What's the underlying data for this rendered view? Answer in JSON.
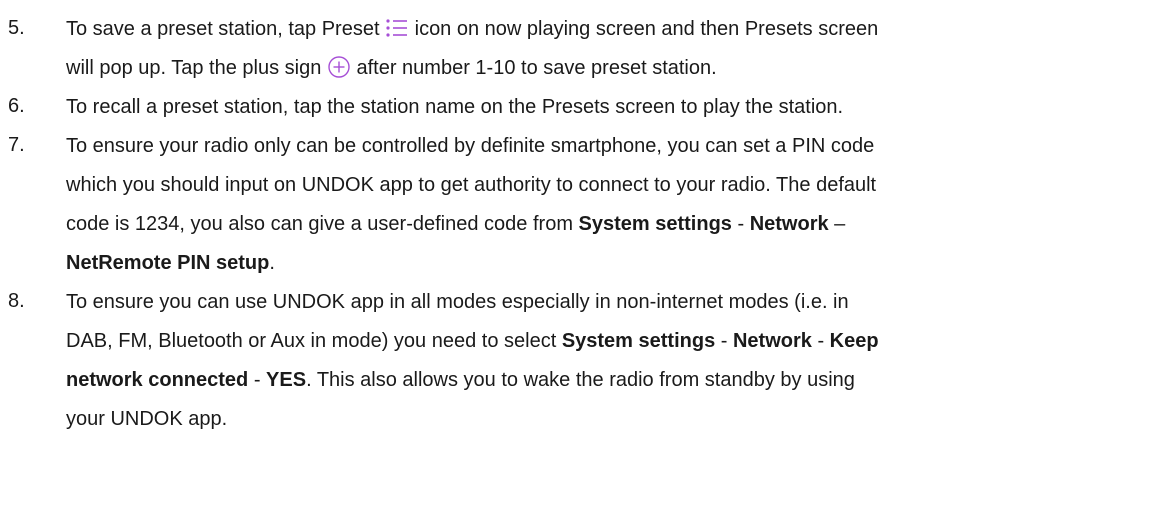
{
  "icons": {
    "preset": "preset-list-icon",
    "plus": "plus-circle-icon",
    "accent_color": "#a64fd6"
  },
  "items": [
    {
      "number": "5.",
      "lines": [
        [
          "To save a preset station, tap Preset ",
          " icon on now playing screen and then Presets screen"
        ],
        [
          "will pop up. Tap the plus sign ",
          " after number 1-10 to save preset station."
        ]
      ]
    },
    {
      "number": "6.",
      "lines": [
        [
          "To recall a preset station, tap the station name on the Presets screen to play the station."
        ]
      ]
    },
    {
      "number": "7.",
      "lines": [
        [
          "To ensure your radio only can be controlled by definite smartphone, you can set a PIN code"
        ],
        [
          "which you should input on UNDOK app to get authority to connect to your radio. The default"
        ],
        [
          "code is 1234, you also can give a user-defined code from ",
          "System settings",
          " - ",
          "Network",
          " –"
        ],
        [
          "NetRemote PIN setup",
          "."
        ]
      ]
    },
    {
      "number": "8.",
      "lines": [
        [
          "To ensure you can use UNDOK app in all modes especially in non-internet modes (i.e. in"
        ],
        [
          "DAB, FM, Bluetooth or Aux in mode) you need to select ",
          "System settings",
          " - ",
          "Network",
          " - ",
          "Keep"
        ],
        [
          "network connected",
          " - ",
          "YES",
          ". This also allows you to wake the radio from standby by using"
        ],
        [
          "your UNDOK app."
        ]
      ]
    }
  ]
}
